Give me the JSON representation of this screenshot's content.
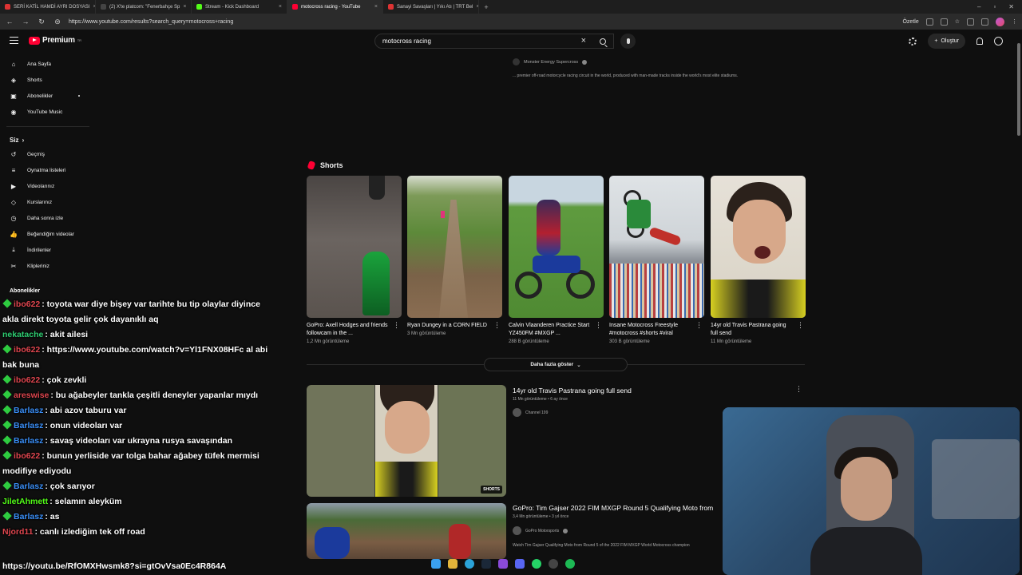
{
  "browser": {
    "tabs": [
      {
        "label": "SERİ KATİL HAMDİ AYRI DOSYASI",
        "color": "#d33"
      },
      {
        "label": "(2) X'te platcom: \"Fenerbahçe Sp",
        "color": "#444"
      },
      {
        "label": "Stream - Kick Dashboard",
        "color": "#53fc18"
      },
      {
        "label": "motocross racing - YouTube",
        "color": "#ff0033"
      },
      {
        "label": "Sanayi Savaşları | Yıkı Atı | TRT Bel",
        "color": "#d33"
      }
    ],
    "active_tab": 3,
    "url": "https://www.youtube.com/results?search_query=motocross+racing",
    "summarize_label": "Özetle"
  },
  "youtube": {
    "logo_text": "Premium",
    "logo_sup": "TR",
    "search_value": "motocross racing",
    "create_label": "Oluştur",
    "sidebar": {
      "main": [
        "Ana Sayfa",
        "Shorts",
        "Abonelikler",
        "YouTube Music"
      ],
      "you_header": "Siz",
      "you_items": [
        "Geçmiş",
        "Oynatma listeleri",
        "Videolarınız",
        "Kurslarınız",
        "Daha sonra izle",
        "Beğendiğim videolar",
        "İndirilenler",
        "Klipleriniz"
      ],
      "subs_header": "Abonelikler"
    },
    "top_result": {
      "channel": "Monster Energy Supercross",
      "description": "... premier off-road motorcycle racing circuit in the world, produced with man-made tracks inside the world's most elite stadiums."
    },
    "shorts_header": "Shorts",
    "shorts": [
      {
        "title": "GoPro: Axell Hodges and friends followcam in the ...",
        "views": "1,2 Mn görüntüleme"
      },
      {
        "title": "Ryan Dungey in a CORN FIELD",
        "views": "3 Mn görüntüleme"
      },
      {
        "title": "Calvin Vlaanderen Practice Start YZ450FM #MXGP ...",
        "views": "288 B görüntüleme"
      },
      {
        "title": "Insane Motocross Freestyle #motocross #shorts #viral",
        "views": "303 B görüntüleme"
      },
      {
        "title": "14yr old Travis Pastrana going full send",
        "views": "11 Mn görüntüleme"
      }
    ],
    "show_more": "Daha fazla göster",
    "videos": [
      {
        "title": "14yr old Travis Pastrana going full send",
        "meta": "11 Mn görüntüleme • 6 ay önce",
        "channel": "Channel 199",
        "badge": "SHORTS"
      },
      {
        "title": "GoPro: Tim Gajser 2022 FIM MXGP Round 5 Qualifying Moto from",
        "meta": "3,4 Mn görüntüleme • 3 yıl önce",
        "channel": "GoPro Motorsports",
        "description": "Watch Tim Gajser Qualifying Moto from Round 5 of the 2022 FIM MXGP World Motocross champion"
      }
    ]
  },
  "chat": [
    {
      "user": "ibo622",
      "text": ": toyota war diye bişey var tarihte bu tip olaylar diyince akla direkt toyota gelir çok dayanıklı aq",
      "color": "#e0464f",
      "badge": true
    },
    {
      "user": "nekatache",
      "text": ": akit ailesi",
      "color": "#2ecc71",
      "badge": false
    },
    {
      "user": "ibo622",
      "text": ": https://www.youtube.com/watch?v=Yl1FNX08HFc al abi bak buna",
      "color": "#e0464f",
      "badge": true
    },
    {
      "user": "ibo622",
      "text": ": çok zevkli",
      "color": "#e0464f",
      "badge": true
    },
    {
      "user": "areswise",
      "text": ": bu ağabeyler tankla çeşitli deneyler yapanlar mıydı",
      "color": "#e0464f",
      "badge": true
    },
    {
      "user": "Barlasz",
      "text": ": abi azov taburu var",
      "color": "#3a8ef6",
      "badge": true
    },
    {
      "user": "Barlasz",
      "text": ": onun videoları var",
      "color": "#3a8ef6",
      "badge": true
    },
    {
      "user": "Barlasz",
      "text": ": savaş videoları var ukrayna rusya savaşından",
      "color": "#3a8ef6",
      "badge": true
    },
    {
      "user": "ibo622",
      "text": ": bunun yerliside var tolga bahar ağabey tüfek mermisi modifiye ediyodu",
      "color": "#e0464f",
      "badge": true
    },
    {
      "user": "Barlasz",
      "text": ": çok sarıyor",
      "color": "#3a8ef6",
      "badge": true
    },
    {
      "user": "JiletAhmett",
      "text": ": selamın aleyküm",
      "color": "#53fc18",
      "badge": false
    },
    {
      "user": "Barlasz",
      "text": ": as",
      "color": "#3a8ef6",
      "badge": true
    },
    {
      "user": "Njord11",
      "text": ": canlı izlediğim tek off road",
      "color": "#e0464f",
      "badge": false
    }
  ],
  "chat_link": "https://youtu.be/RfOMXHwsmk8?si=gtOvVsa0Ec4R864A"
}
